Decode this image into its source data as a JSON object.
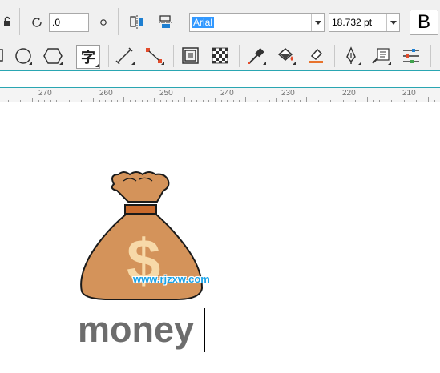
{
  "toolbar": {
    "rotation_value": ".0",
    "font_name": "Arial",
    "font_size": "18.732 pt",
    "bold_label": "B"
  },
  "ruler": {
    "labels": [
      "270",
      "260",
      "250",
      "240",
      "230",
      "220",
      "210"
    ]
  },
  "canvas": {
    "text": "money",
    "watermark": "www.rjzxw.com",
    "dollar_sign": "$"
  },
  "colors": {
    "bag_fill": "#d4935a",
    "bag_band": "#c96a2c",
    "dollar": "#f7d9a8",
    "text": "#6d6d6d",
    "accent_line": "#2aa6b2",
    "selection": "#3399ff"
  },
  "icons": [
    "lock-icon",
    "rotate-icon",
    "mirror-horizontal-icon",
    "mirror-vertical-icon",
    "rectangle-tool-icon",
    "ellipse-tool-icon",
    "polygon-tool-icon",
    "text-tool-icon",
    "dimension-tool-icon",
    "connector-tool-icon",
    "contour-icon",
    "transparency-icon",
    "eyedropper-icon",
    "fill-icon",
    "interactive-fill-icon",
    "pen-icon",
    "smart-fill-icon",
    "align-distribute-icon"
  ]
}
